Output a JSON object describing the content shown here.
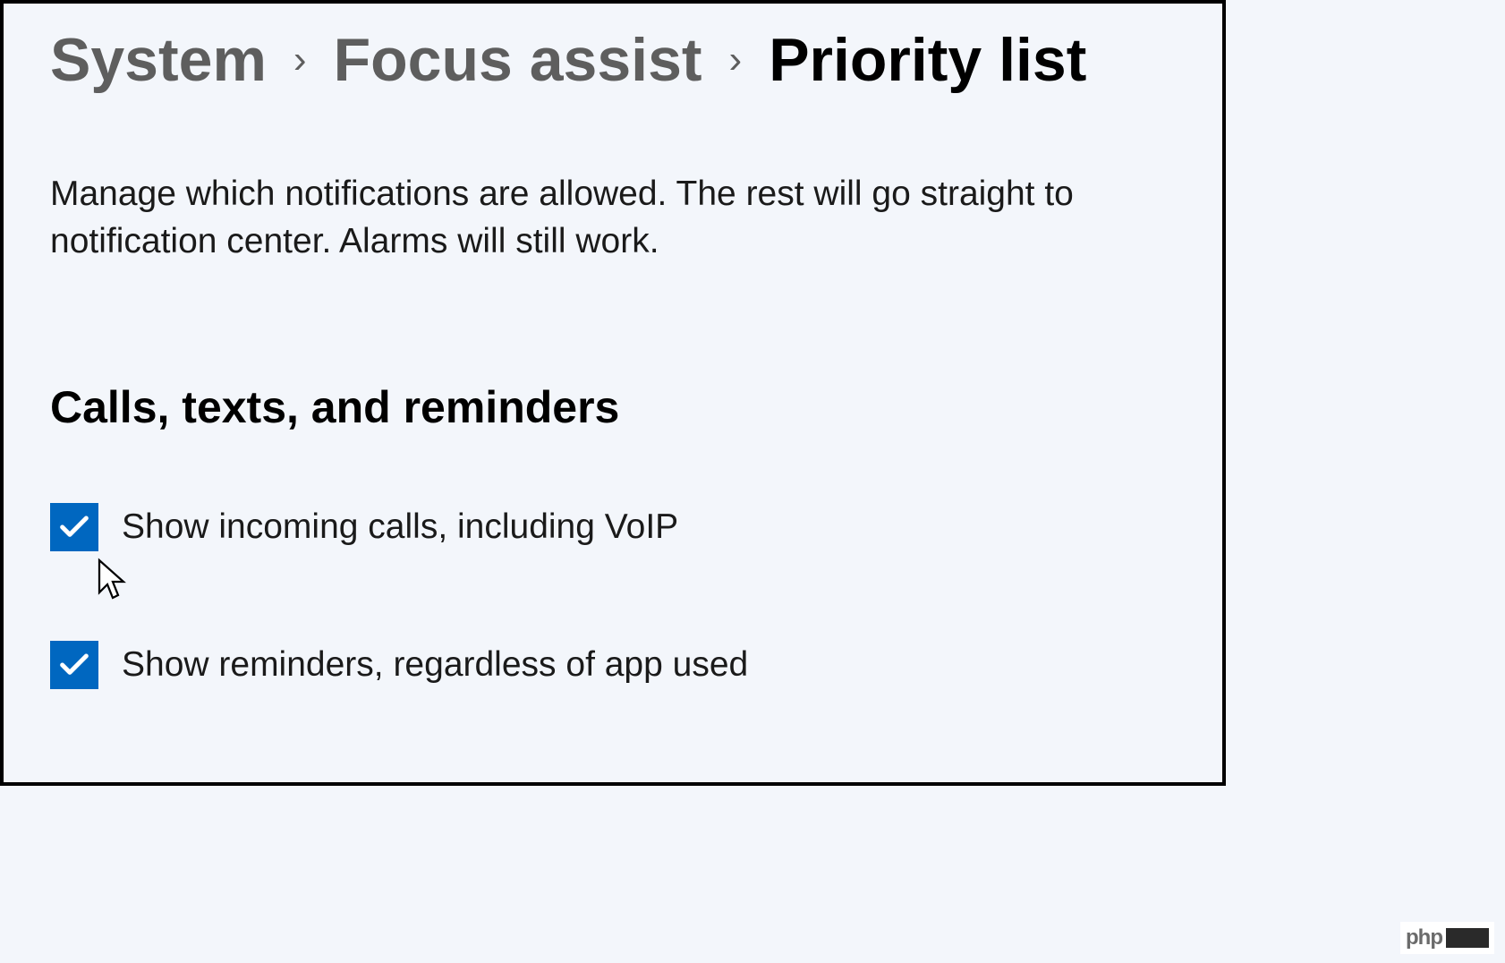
{
  "breadcrumb": {
    "system": "System",
    "focus_assist": "Focus assist",
    "priority_list": "Priority list"
  },
  "description": "Manage which notifications are allowed. The rest will go straight to notification center. Alarms will still work.",
  "section_heading": "Calls, texts, and reminders",
  "checkboxes": {
    "incoming_calls": {
      "label": "Show incoming calls, including VoIP",
      "checked": true
    },
    "reminders": {
      "label": "Show reminders, regardless of app used",
      "checked": true
    }
  },
  "watermark": "php"
}
